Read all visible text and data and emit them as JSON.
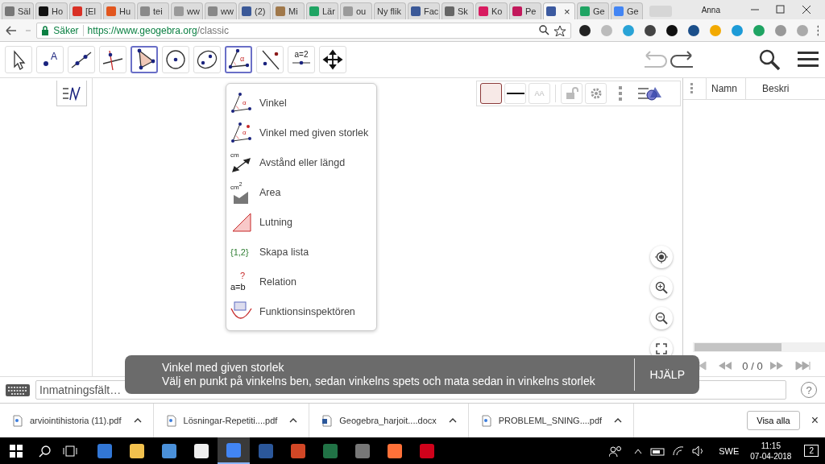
{
  "browser": {
    "user": "Anna",
    "tabs": [
      {
        "label": "Säl",
        "color": "#777777",
        "selected": false
      },
      {
        "label": "Ho",
        "color": "#111111",
        "selected": false
      },
      {
        "label": "[El",
        "color": "#d93025",
        "selected": false
      },
      {
        "label": "Hu",
        "color": "#e2561e",
        "selected": false
      },
      {
        "label": "tei",
        "color": "#8a8a8a",
        "selected": false
      },
      {
        "label": "ww",
        "color": "#9a9a9a",
        "selected": false
      },
      {
        "label": "ww",
        "color": "#888888",
        "selected": false
      },
      {
        "label": "(2)",
        "color": "#3b5998",
        "selected": false
      },
      {
        "label": "Mi",
        "color": "#a0784a",
        "selected": false
      },
      {
        "label": "Lär",
        "color": "#1fa463",
        "selected": false
      },
      {
        "label": "ou",
        "color": "#9a9a9a",
        "selected": false
      },
      {
        "label": "Ny flik",
        "selected": false
      },
      {
        "label": "Fac",
        "color": "#3b5998",
        "selected": false
      },
      {
        "label": "Sk",
        "color": "#666666",
        "selected": false
      },
      {
        "label": "Ko",
        "color": "#d81b60",
        "selected": false
      },
      {
        "label": "Pe",
        "color": "#c2185b",
        "selected": false
      },
      {
        "close": "×",
        "color": "#3c5aa0",
        "selected": true
      },
      {
        "label": "Ge",
        "color": "#1fa463",
        "selected": false
      },
      {
        "label": "Ge",
        "color": "#4285f4",
        "selected": false
      }
    ],
    "secure_label": "Säker",
    "url_host": "https://www.geogebra.org",
    "url_path": "/classic",
    "extensions": [
      {
        "color": "#222222"
      },
      {
        "color": "#bbbbbb"
      },
      {
        "color": "#29a3d6"
      },
      {
        "color": "#444444"
      },
      {
        "color": "#111111"
      },
      {
        "color": "#1b4f8a"
      },
      {
        "color": "#f2a900"
      },
      {
        "color": "#1d9bd7"
      },
      {
        "color": "#1fa463"
      },
      {
        "color": "#999999"
      },
      {
        "color": "#aaaaaa"
      }
    ]
  },
  "toolbar": {
    "tools": [
      {
        "kind": "move",
        "selected": false
      },
      {
        "kind": "point",
        "label": "A",
        "selected": false
      },
      {
        "kind": "line",
        "selected": false
      },
      {
        "kind": "perpendicular",
        "selected": false
      },
      {
        "kind": "polygon",
        "selected": true
      },
      {
        "kind": "circle",
        "selected": false
      },
      {
        "kind": "conic",
        "selected": false
      },
      {
        "kind": "angle",
        "label": "α",
        "selected": true
      },
      {
        "kind": "reflect",
        "selected": false
      },
      {
        "kind": "slider",
        "label": "a=2",
        "selected": false
      },
      {
        "kind": "pan",
        "selected": false
      }
    ]
  },
  "tool_menu": [
    {
      "kind": "angle",
      "label": "Vinkel",
      "icon_texts": [
        "α"
      ]
    },
    {
      "kind": "angle-size",
      "label": "Vinkel med given storlek",
      "icon_texts": [
        "α"
      ]
    },
    {
      "kind": "distance",
      "label": "Avstånd eller längd",
      "icon_texts": [
        "cm"
      ]
    },
    {
      "kind": "area",
      "label": "Area",
      "icon_texts": [
        "cm$^{2}$"
      ]
    },
    {
      "kind": "slope",
      "label": "Lutning"
    },
    {
      "kind": "list",
      "label": "Skapa lista",
      "icon_texts": [
        "{1,2}"
      ]
    },
    {
      "kind": "relation",
      "label": "Relation",
      "icon_texts": [
        "?",
        "a=b"
      ]
    },
    {
      "kind": "inspector",
      "label": "Funktionsinspektören"
    }
  ],
  "style_bar": {
    "font_button": "AA"
  },
  "table": {
    "columns": [
      "Namn",
      "Beskri"
    ],
    "pager": "0 / 0"
  },
  "tooltip": {
    "title": "Vinkel med given storlek",
    "text": "Välj en punkt på vinkelns ben, sedan vinkelns spets och mata sedan in vinkelns storlek",
    "button": "HJÄLP"
  },
  "input_bar": {
    "placeholder": "Inmatningsfält…",
    "help": "?"
  },
  "downloads": {
    "files": [
      {
        "name": "arviointihistoria (11).pdf",
        "kind": "pdf"
      },
      {
        "name": "Lösningar-Repetiti....pdf",
        "kind": "pdf"
      },
      {
        "name": "Geogebra_harjoit....docx",
        "kind": "docx"
      },
      {
        "name": "PROBLEML_SNING....pdf",
        "kind": "pdf"
      }
    ],
    "show_all": "Visa alla",
    "close": "×"
  },
  "taskbar": {
    "apps": [
      {
        "color": "#3277d6",
        "selected": false
      },
      {
        "color": "#f2c14e",
        "selected": false
      },
      {
        "color": "#4a90d9",
        "selected": false
      },
      {
        "color": "#eeeeee",
        "selected": false
      },
      {
        "color": "#4285f4",
        "selected": true
      },
      {
        "color": "#2b579a",
        "selected": false
      },
      {
        "color": "#d24726",
        "selected": false
      },
      {
        "color": "#217346",
        "selected": false
      },
      {
        "color": "#777777",
        "selected": false
      },
      {
        "color": "#ff7139",
        "selected": false
      },
      {
        "color": "#d0021b",
        "selected": false
      }
    ],
    "language": "SWE",
    "time": "11:15",
    "date": "07-04-2018",
    "notifications": "2"
  }
}
